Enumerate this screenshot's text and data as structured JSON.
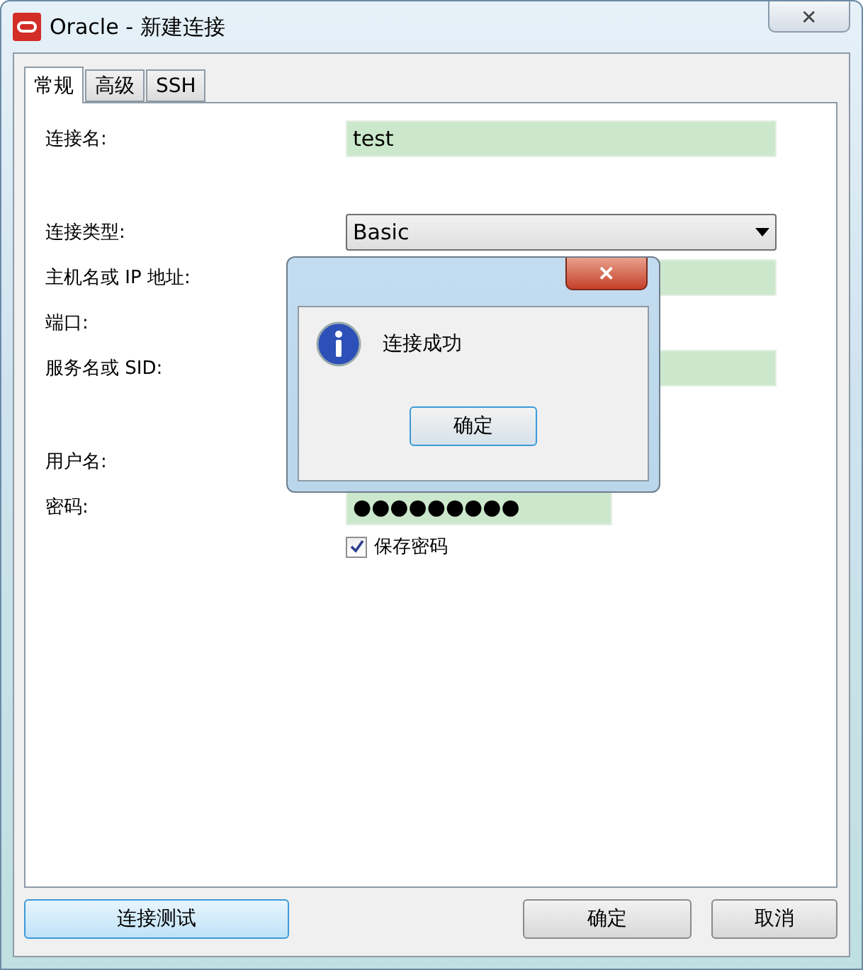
{
  "window": {
    "title": "Oracle - 新建连接",
    "close": "✕"
  },
  "tabs": [
    {
      "label": "常规",
      "selected": true
    },
    {
      "label": "高级",
      "selected": false
    },
    {
      "label": "SSH",
      "selected": false
    }
  ],
  "form": {
    "groups": [
      [
        {
          "label": "连接名:",
          "kind": "field",
          "value": "test"
        }
      ],
      [
        {
          "label": "连接类型:",
          "kind": "select",
          "value": "Basic"
        },
        {
          "label": "主机名或 IP 地址:",
          "kind": "field"
        },
        {
          "label": "端口:",
          "kind": "none"
        },
        {
          "label": "服务名或 SID:",
          "kind": "field"
        }
      ],
      [
        {
          "label": "用户名:",
          "kind": "none"
        },
        {
          "label": "密码:",
          "kind": "password",
          "value": "●●●●●●●●●"
        }
      ]
    ],
    "save_password": {
      "label": "保存密码",
      "checked": true
    }
  },
  "message_box": {
    "close": "✕",
    "message": "连接成功",
    "button": "确定"
  },
  "footer": {
    "test_button": "连接测试",
    "buttons": [
      "确定",
      "取消"
    ]
  }
}
